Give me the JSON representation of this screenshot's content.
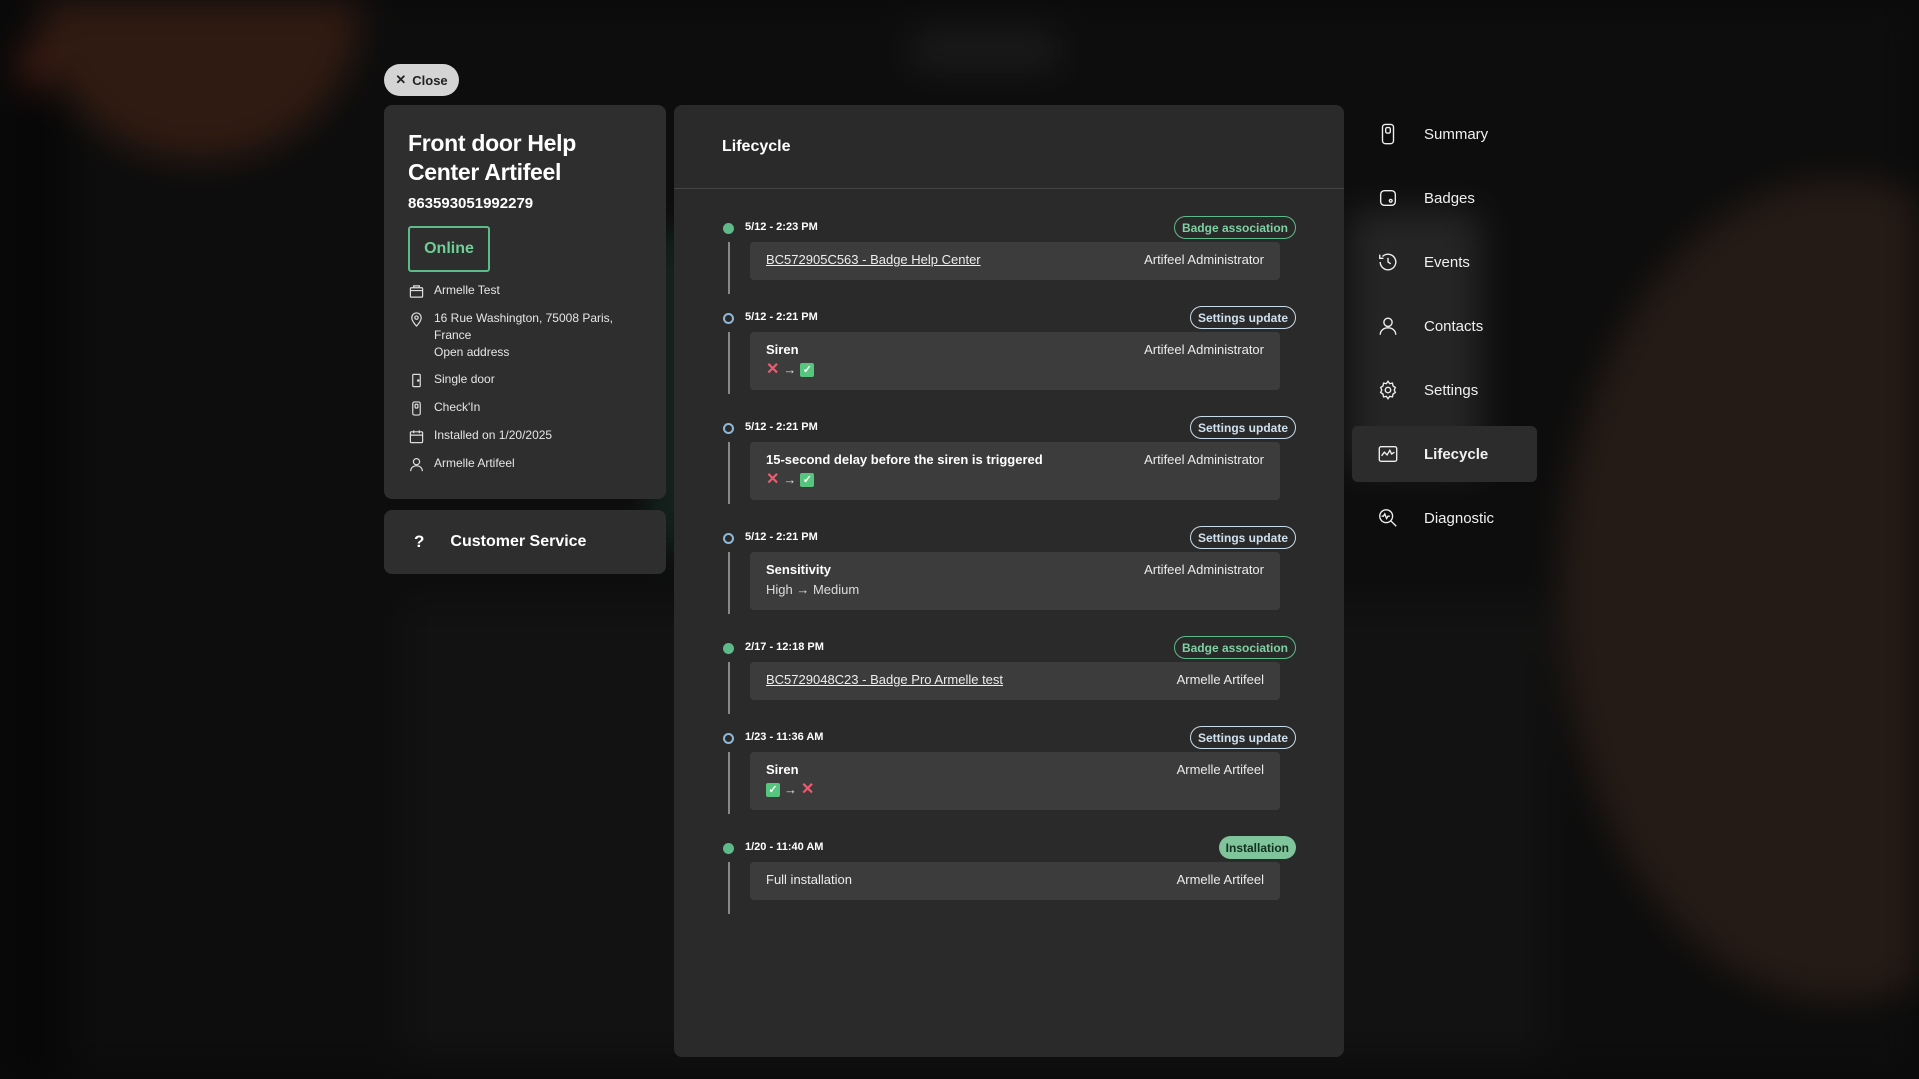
{
  "close_label": "Close",
  "device": {
    "title": "Front door Help Center Artifeel",
    "serial": "863593051992279",
    "status": "Online",
    "info": {
      "owner": "Armelle Test",
      "address_line1": "16 Rue Washington, 75008 Paris, France",
      "address_line2": "Open address",
      "door_type": "Single door",
      "product": "Check'In",
      "installed": "Installed on 1/20/2025",
      "installer": "Armelle Artifeel"
    }
  },
  "customer_service": {
    "icon": "?",
    "label": "Customer Service"
  },
  "lifecycle": {
    "title": "Lifecycle",
    "entries": [
      {
        "time": "5/12 - 2:23 PM",
        "tag": "Badge association",
        "subject": "BC572905C563 - Badge Help Center",
        "by": "Artifeel Administrator"
      },
      {
        "time": "5/12 - 2:21 PM",
        "tag": "Settings update",
        "subject": "Siren",
        "by": "Artifeel Administrator"
      },
      {
        "time": "5/12 - 2:21 PM",
        "tag": "Settings update",
        "subject": "15-second delay before the siren is triggered",
        "by": "Artifeel Administrator"
      },
      {
        "time": "5/12 - 2:21 PM",
        "tag": "Settings update",
        "subject": "Sensitivity",
        "by": "Artifeel Administrator",
        "change": "High → Medium"
      },
      {
        "time": "2/17 - 12:18 PM",
        "tag": "Badge association",
        "subject": "BC5729048C23 - Badge Pro Armelle test",
        "by": "Armelle Artifeel"
      },
      {
        "time": "1/23 - 11:36 AM",
        "tag": "Settings update",
        "subject": "Siren",
        "by": "Armelle Artifeel"
      },
      {
        "time": "1/20 - 11:40 AM",
        "tag": "Installation",
        "subject": "Full installation",
        "by": "Armelle Artifeel"
      }
    ]
  },
  "nav": {
    "summary": "Summary",
    "badges": "Badges",
    "events": "Events",
    "contacts": "Contacts",
    "settings": "Settings",
    "lifecycle": "Lifecycle",
    "diagnostic": "Diagnostic"
  },
  "colors": {
    "online": "#6fcf97",
    "accent_green": "#5dbb8a",
    "cross_red": "#ee5a6f"
  }
}
